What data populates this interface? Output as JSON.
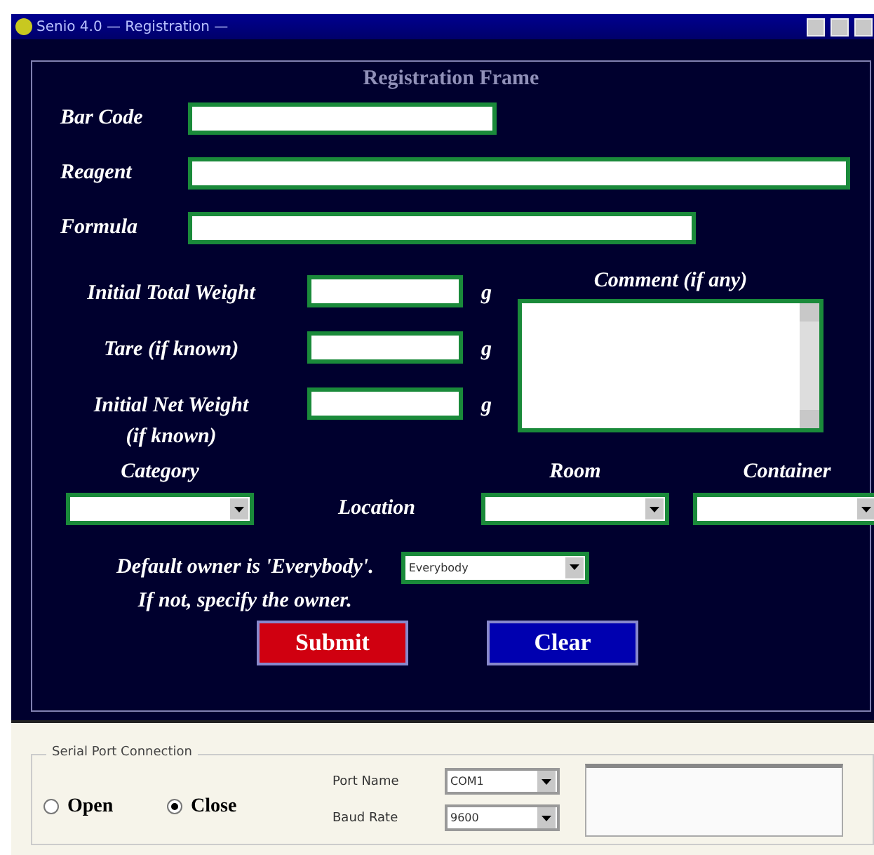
{
  "window": {
    "title": "Senio 4.0 — Registration —"
  },
  "frame": {
    "title": "Registration Frame"
  },
  "fields": [
    {
      "label": "Bar Code"
    },
    {
      "label": "Reagent"
    },
    {
      "label": "Formula"
    }
  ],
  "weights": [
    {
      "label": "Initial Total Weight",
      "unit": "g"
    },
    {
      "label": "Tare (if known)",
      "unit": "g"
    },
    {
      "label": "Initial Net Weight (if known)",
      "unit": "g"
    }
  ],
  "comment": {
    "label": "Comment (if any)"
  },
  "category": {
    "label": "Category"
  },
  "location": {
    "label": "Location",
    "room": "Room",
    "container": "Container"
  },
  "owner": {
    "lines": [
      "Default owner is 'Everybody'.",
      "If not, specify the owner."
    ],
    "value": "Everybody"
  },
  "buttons": [
    {
      "label": "Submit",
      "kind": "submit"
    },
    {
      "label": "Clear",
      "kind": "clear"
    }
  ],
  "serial": {
    "legend": "Serial Port Connection",
    "options": [
      {
        "label": "Open",
        "selected": false
      },
      {
        "label": "Close",
        "selected": true
      }
    ],
    "port_name": {
      "label": "Port Name",
      "value": "COM1"
    },
    "baud_rate": {
      "label": "Baud Rate",
      "value": "9600"
    }
  }
}
